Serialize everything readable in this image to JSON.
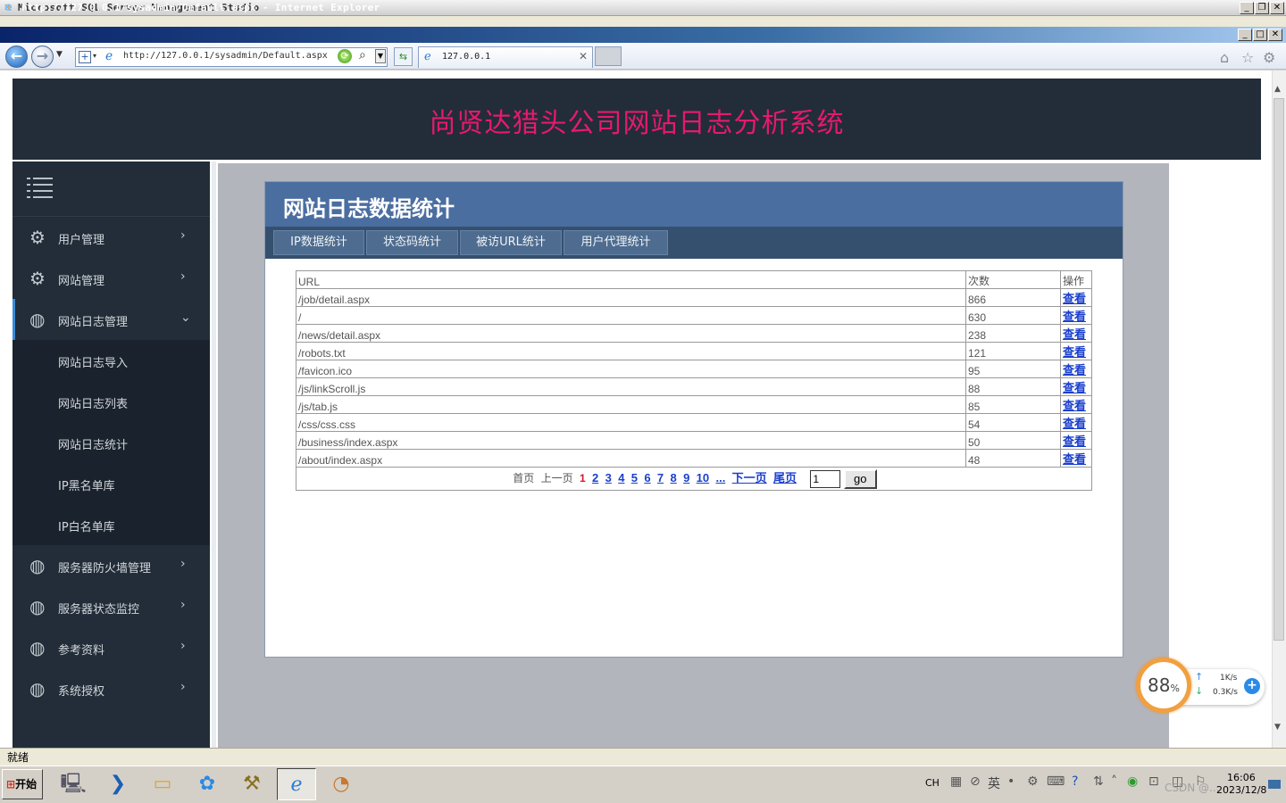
{
  "ssms": {
    "title": "Microsoft SQL Server Management Studio"
  },
  "ie": {
    "title": "http://127.0.0.1/sysadmin/Default.aspx - Internet Explorer",
    "address": "http://127.0.0.1/sysadmin/Default.aspx",
    "tab_title": "127.0.0.1",
    "status": "就绪"
  },
  "site": {
    "title": "尚贤达猎头公司网站日志分析系统"
  },
  "sidebar": {
    "items": [
      {
        "label": "用户管理",
        "icon": "gear-icon",
        "type": "group"
      },
      {
        "label": "网站管理",
        "icon": "gear-icon",
        "type": "group"
      },
      {
        "label": "网站日志管理",
        "icon": "globe-icon",
        "type": "group-open"
      },
      {
        "label": "网站日志导入",
        "type": "sub"
      },
      {
        "label": "网站日志列表",
        "type": "sub"
      },
      {
        "label": "网站日志统计",
        "type": "sub"
      },
      {
        "label": "IP黑名单库",
        "type": "sub"
      },
      {
        "label": "IP白名单库",
        "type": "sub"
      },
      {
        "label": "服务器防火墙管理",
        "icon": "globe-icon",
        "type": "group"
      },
      {
        "label": "服务器状态监控",
        "icon": "globe-icon",
        "type": "group"
      },
      {
        "label": "参考资料",
        "icon": "globe-icon",
        "type": "group"
      },
      {
        "label": "系统授权",
        "icon": "globe-icon",
        "type": "group"
      }
    ]
  },
  "panel": {
    "title": "网站日志数据统计",
    "tabs": [
      "IP数据统计",
      "状态码统计",
      "被访URL统计",
      "用户代理统计"
    ]
  },
  "table": {
    "headers": [
      "URL",
      "次数",
      "操作"
    ],
    "rows": [
      {
        "url": "/job/detail.aspx",
        "count": "866",
        "action": "查看"
      },
      {
        "url": "/",
        "count": "630",
        "action": "查看"
      },
      {
        "url": "/news/detail.aspx",
        "count": "238",
        "action": "查看"
      },
      {
        "url": "/robots.txt",
        "count": "121",
        "action": "查看"
      },
      {
        "url": "/favicon.ico",
        "count": "95",
        "action": "查看"
      },
      {
        "url": "/js/linkScroll.js",
        "count": "88",
        "action": "查看"
      },
      {
        "url": "/js/tab.js",
        "count": "85",
        "action": "查看"
      },
      {
        "url": "/css/css.css",
        "count": "54",
        "action": "查看"
      },
      {
        "url": "/business/index.aspx",
        "count": "50",
        "action": "查看"
      },
      {
        "url": "/about/index.aspx",
        "count": "48",
        "action": "查看"
      }
    ]
  },
  "pager": {
    "first": "首页",
    "prev": "上一页",
    "current": "1",
    "pages": [
      "2",
      "3",
      "4",
      "5",
      "6",
      "7",
      "8",
      "9",
      "10"
    ],
    "ellipsis": "...",
    "next": "下一页",
    "last": "尾页",
    "input_value": "1",
    "go_label": "go"
  },
  "widget": {
    "percent": "88",
    "percent_unit": "%",
    "up_speed": "1K/s",
    "down_speed": "0.3K/s"
  },
  "taskbar": {
    "start_label": "开始",
    "input_indicator": "CH",
    "lang": "英",
    "time": "16:06",
    "date": "2023/12/8",
    "watermark": "CSDN @..."
  },
  "colors": {
    "header_bg": "#222d39",
    "site_title": "#e6196e",
    "panel_head": "#4b6ea0",
    "tab_bar": "#35506f",
    "link": "#1a3fcc",
    "current_page": "#e0102a"
  }
}
